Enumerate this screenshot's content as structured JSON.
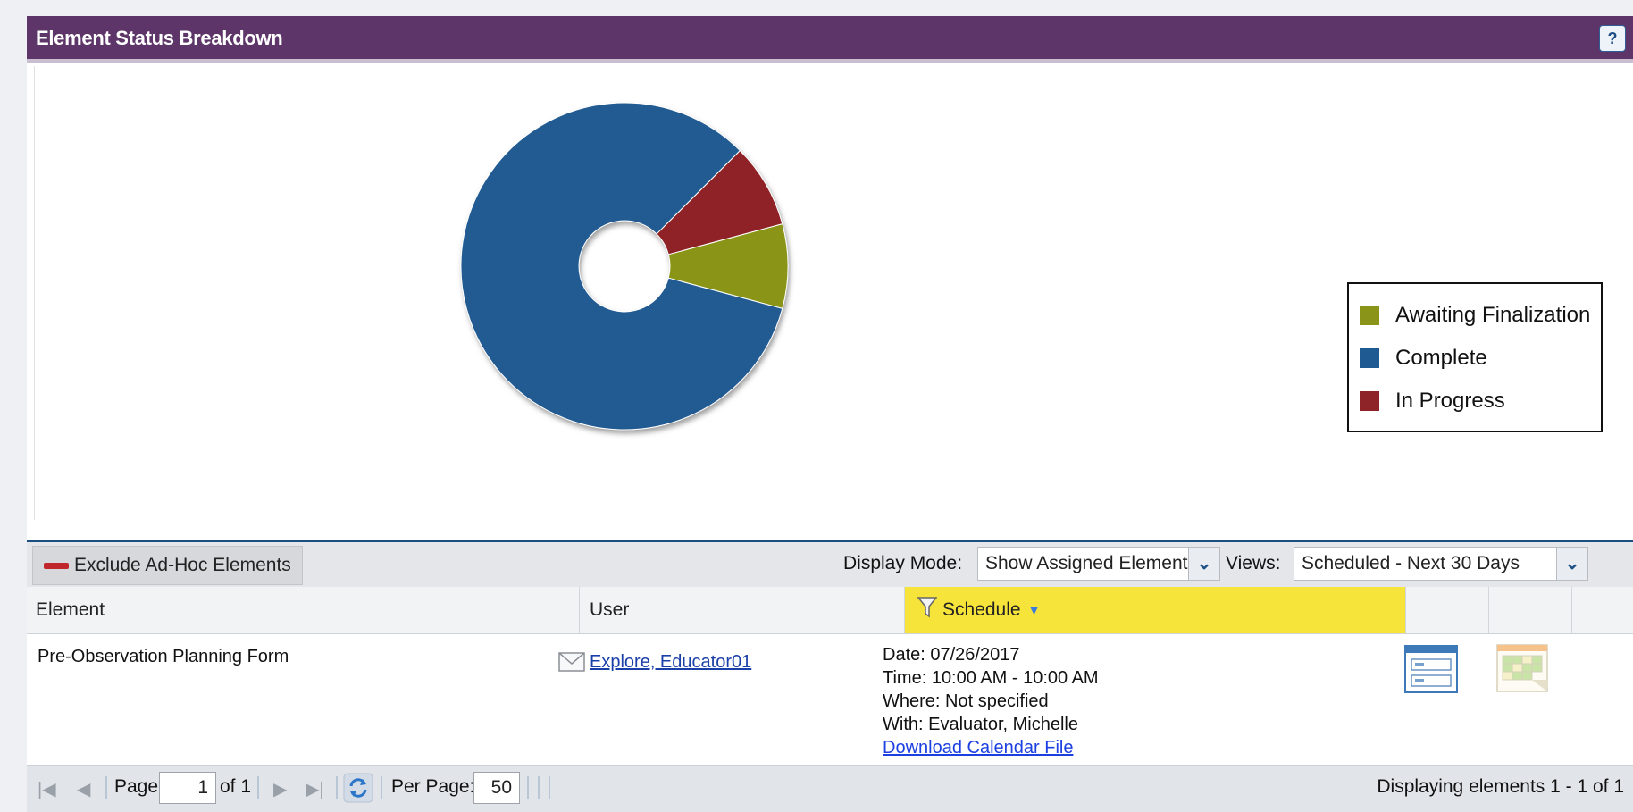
{
  "panel": {
    "title": "Element Status Breakdown",
    "help_label": "?"
  },
  "chart_data": {
    "type": "pie",
    "style": "donut",
    "categories": [
      "Awaiting Finalization",
      "Complete",
      "In Progress"
    ],
    "values": [
      1,
      10,
      1
    ],
    "colors": [
      "#8a9418",
      "#205a92",
      "#8e2428"
    ],
    "legend_placement": "right"
  },
  "legend": {
    "items": [
      {
        "label": "Awaiting Finalization",
        "color": "#8a9418"
      },
      {
        "label": "Complete",
        "color": "#205a92"
      },
      {
        "label": "In Progress",
        "color": "#8e2428"
      }
    ]
  },
  "toolbar": {
    "exclude_label": "Exclude Ad-Hoc Elements",
    "display_mode_label": "Display Mode:",
    "display_mode_value": "Show Assigned Elements",
    "views_label": "Views:",
    "views_value": "Scheduled - Next 30 Days"
  },
  "table": {
    "columns": {
      "element": "Element",
      "user": "User",
      "schedule": "Schedule"
    },
    "rows": [
      {
        "element": "Pre-Observation Planning Form",
        "user": "Explore, Educator01",
        "date": "Date: 07/26/2017",
        "time": "Time: 10:00 AM - 10:00 AM",
        "where": "Where: Not specified",
        "with": "With: Evaluator, Michelle",
        "download": "Download Calendar File"
      }
    ]
  },
  "pager": {
    "page_label": "Page",
    "page_value": "1",
    "of_label": "of 1",
    "per_page_label": "Per Page:",
    "per_page_value": "50",
    "display_text": "Displaying elements 1 - 1 of 1"
  }
}
